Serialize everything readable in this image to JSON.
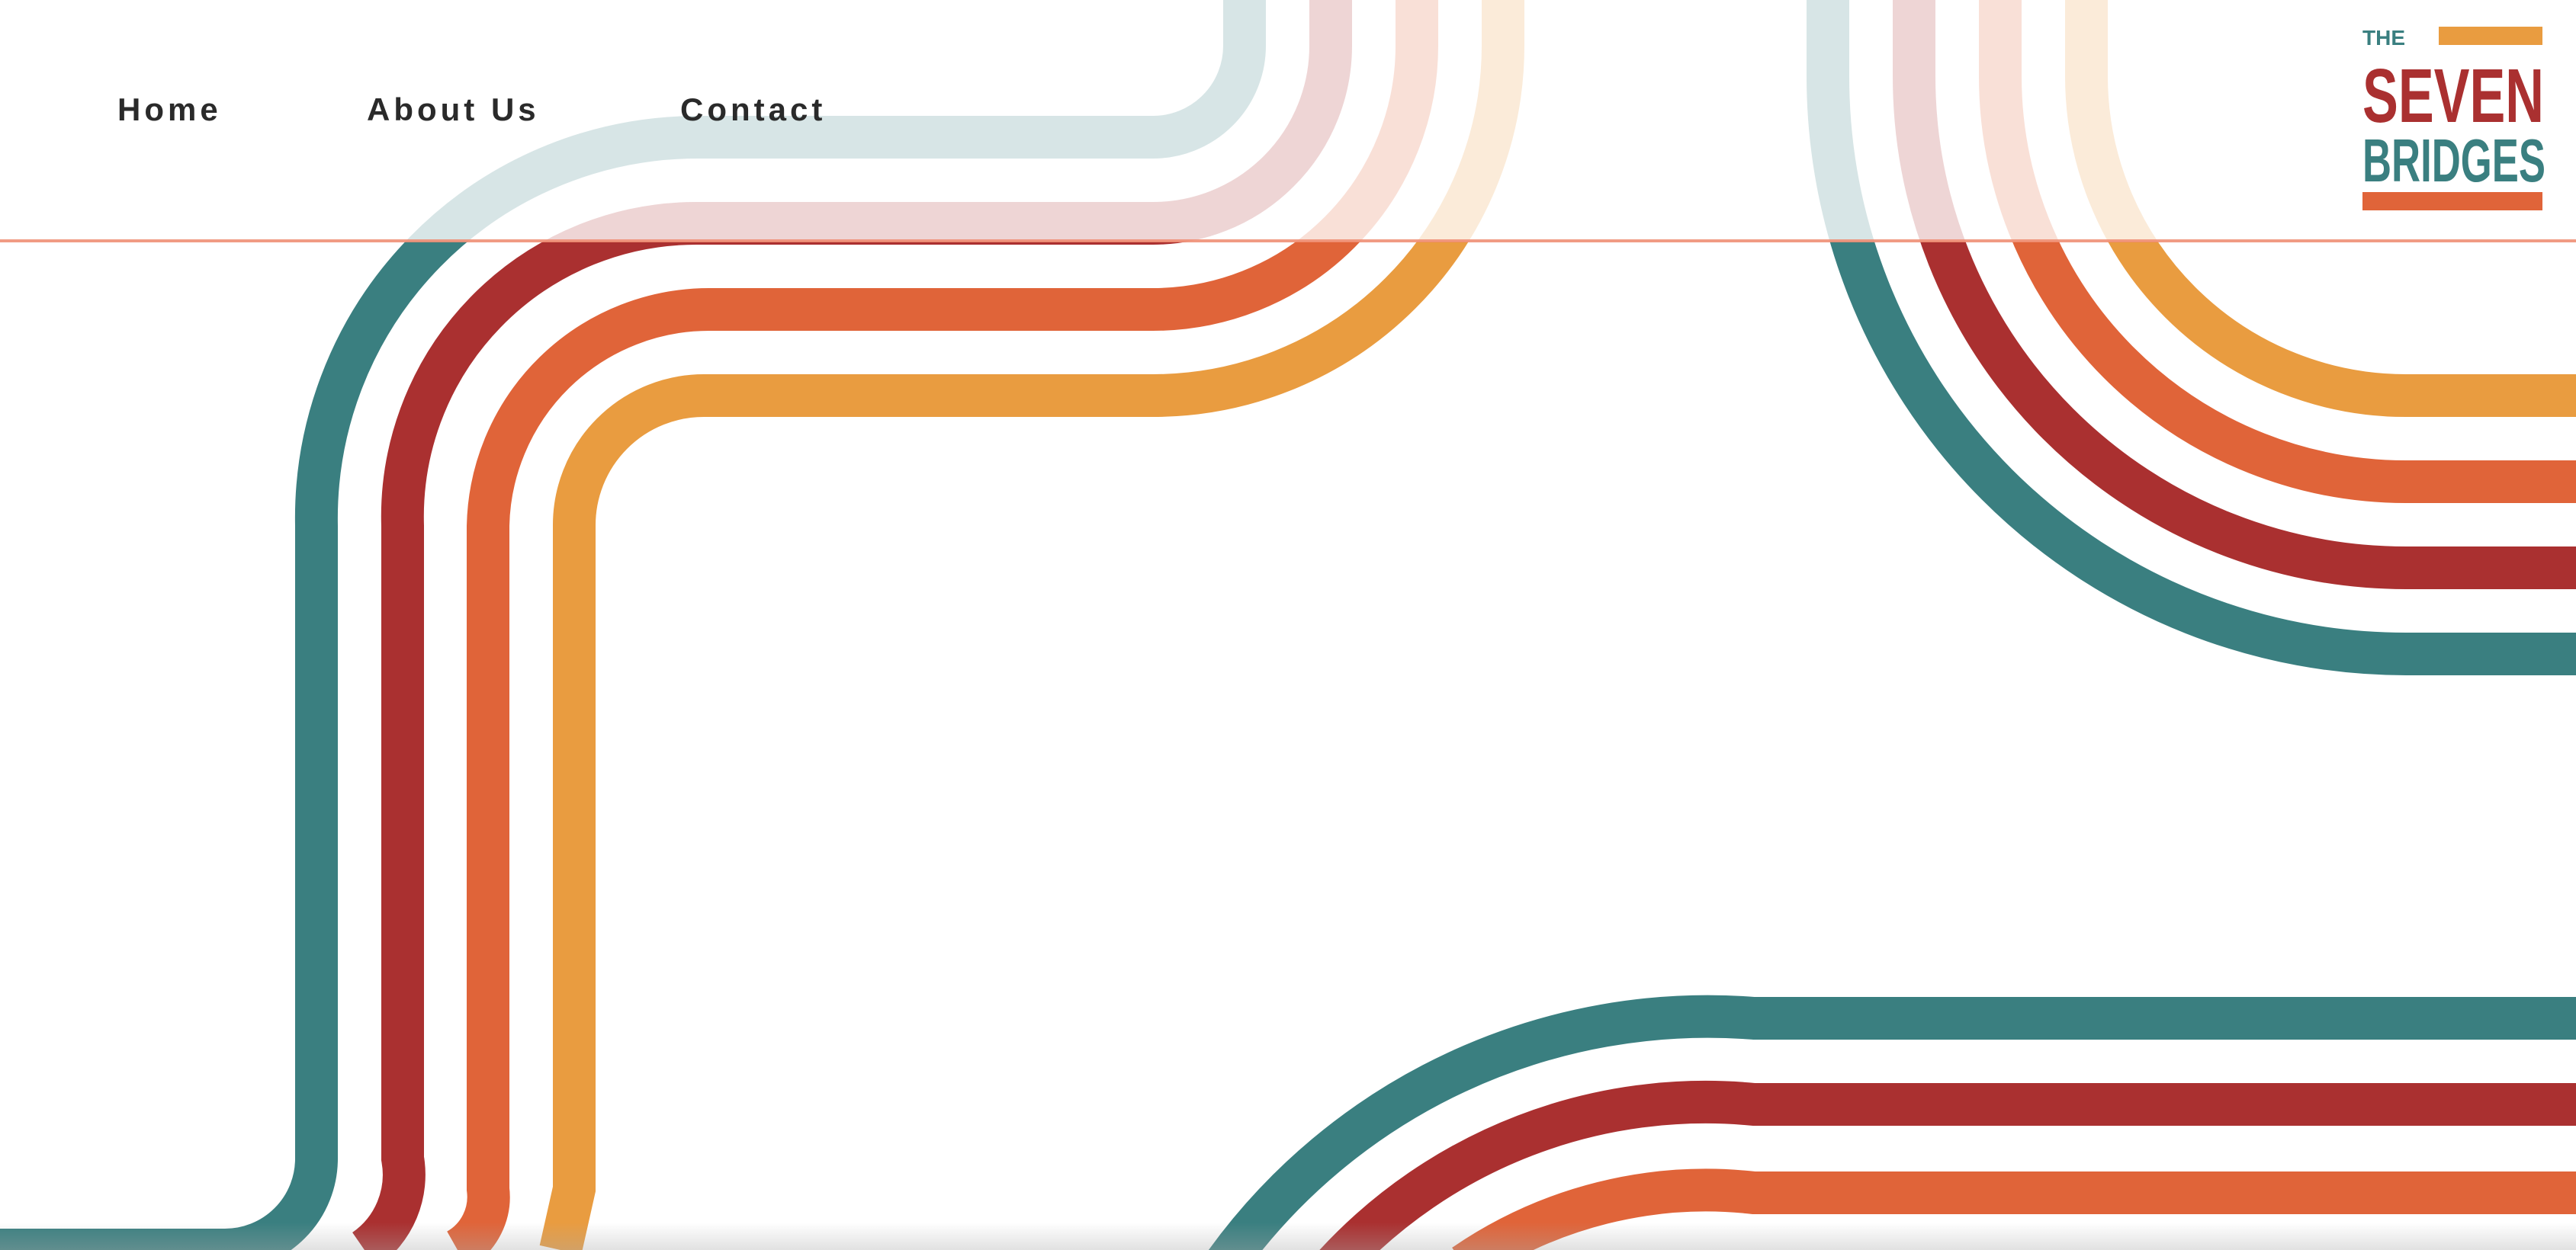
{
  "nav": {
    "items": [
      {
        "label": "Home"
      },
      {
        "label": "About Us"
      },
      {
        "label": "Contact"
      }
    ]
  },
  "logo": {
    "the": "THE",
    "seven": "SEVEN",
    "bridges": "BRIDGES"
  },
  "colors": {
    "teal": "#3a7f80",
    "red": "#aa3030",
    "orange": "#e06439",
    "gold": "#e99c40",
    "nav_text": "#2a2a2a",
    "header_rule": "#ee8a6f"
  }
}
